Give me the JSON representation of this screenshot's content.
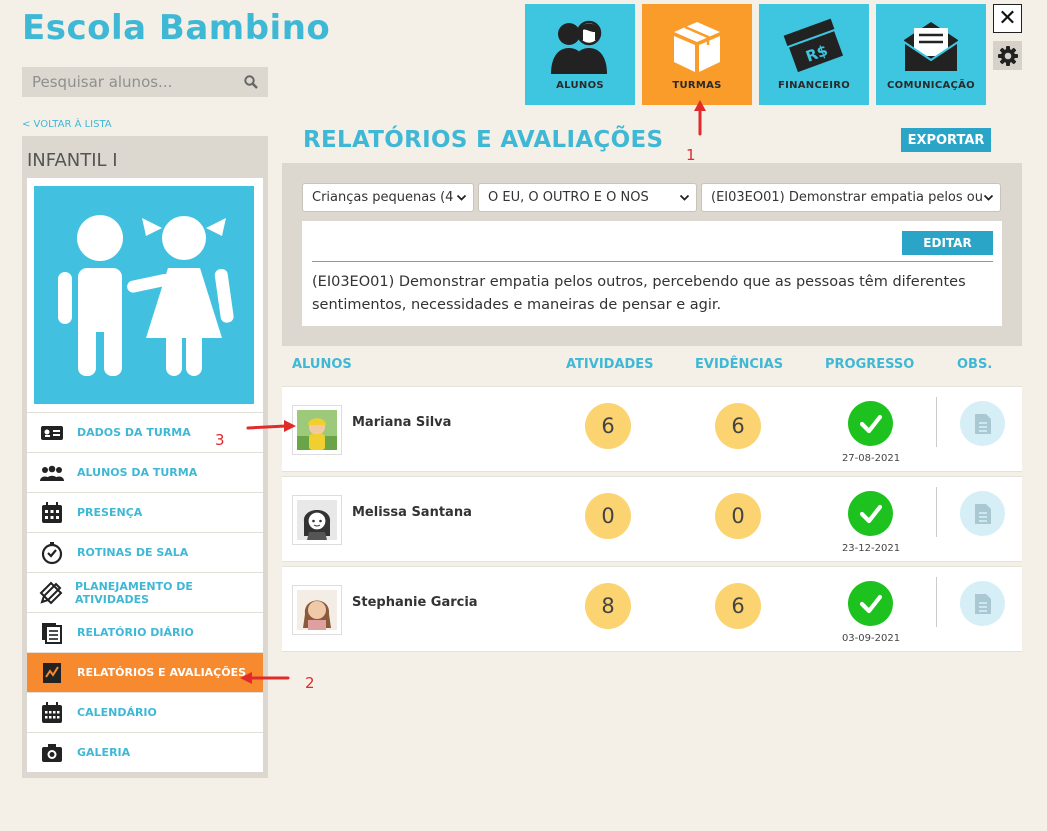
{
  "app": {
    "title": "Escola Bambino"
  },
  "search": {
    "placeholder": "Pesquisar alunos..."
  },
  "topnav": [
    {
      "label": "ALUNOS",
      "icon": "students-icon"
    },
    {
      "label": "TURMAS",
      "icon": "box-icon",
      "active": true
    },
    {
      "label": "FINANCEIRO",
      "icon": "money-icon"
    },
    {
      "label": "COMUNICAÇÃO",
      "icon": "envelope-icon"
    }
  ],
  "back_link": "< VOLTAR À LISTA",
  "sidebar": {
    "class_name": "INFANTIL I",
    "menu": [
      {
        "label": "DADOS DA TURMA",
        "icon": "id-card-icon"
      },
      {
        "label": "ALUNOS DA TURMA",
        "icon": "group-icon"
      },
      {
        "label": "PRESENÇA",
        "icon": "calendar-grid-icon"
      },
      {
        "label": "ROTINAS DE SALA",
        "icon": "timer-icon"
      },
      {
        "label": "PLANEJAMENTO DE ATIVIDADES",
        "icon": "pencil-ruler-icon"
      },
      {
        "label": "RELATÓRIO DIÁRIO",
        "icon": "documents-icon"
      },
      {
        "label": "RELATÓRIOS E AVALIAÇÕES",
        "icon": "report-chart-icon",
        "active": true
      },
      {
        "label": "CALENDÁRIO",
        "icon": "calendar-icon"
      },
      {
        "label": "GALERIA",
        "icon": "camera-icon"
      }
    ]
  },
  "main": {
    "title": "RELATÓRIOS E AVALIAÇÕES",
    "export_label": "EXPORTAR",
    "filters": [
      "Crianças pequenas (4",
      "O EU, O OUTRO E O NÓS",
      "(EI03EO01) Demonstrar empatia pelos ou"
    ],
    "edit_label": "EDITAR",
    "description": "(EI03EO01) Demonstrar empatia pelos outros, percebendo que as pessoas têm diferentes sentimentos, necessidades e maneiras de pensar e agir.",
    "columns": {
      "students": "ALUNOS",
      "activities": "ATIVIDADES",
      "evidences": "EVIDÊNCIAS",
      "progress": "PROGRESSO",
      "obs": "OBS."
    },
    "rows": [
      {
        "name": "Mariana Silva",
        "activities": "6",
        "evidences": "6",
        "date": "27-08-2021"
      },
      {
        "name": "Melissa Santana",
        "activities": "0",
        "evidences": "0",
        "date": "23-12-2021"
      },
      {
        "name": "Stephanie Garcia",
        "activities": "8",
        "evidences": "6",
        "date": "03-09-2021"
      }
    ]
  },
  "annotations": [
    "1",
    "2",
    "3"
  ],
  "colors": {
    "accent": "#3fb8d6",
    "active": "#f99c29",
    "tile": "#3ec6e0",
    "check": "#1ec21e",
    "badge": "#fbd371"
  }
}
